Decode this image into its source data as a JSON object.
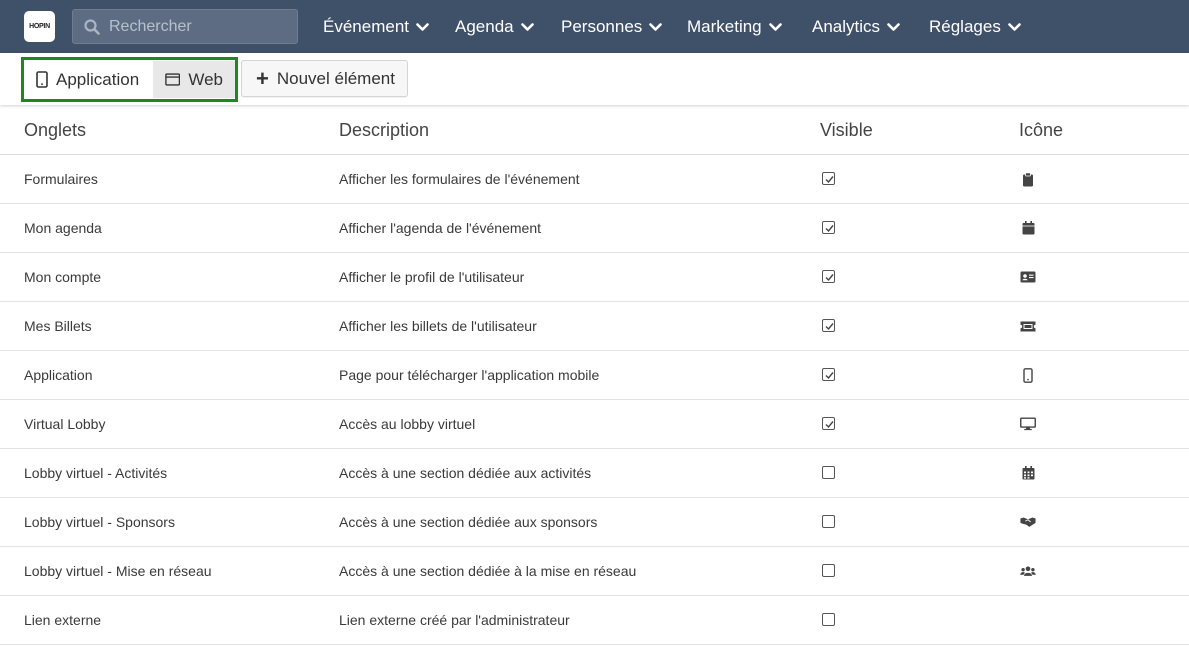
{
  "navbar": {
    "logo_text": "HOPIN",
    "search_placeholder": "Rechercher",
    "menu": [
      {
        "label": "Événement"
      },
      {
        "label": "Agenda"
      },
      {
        "label": "Personnes"
      },
      {
        "label": "Marketing"
      },
      {
        "label": "Analytics"
      },
      {
        "label": "Réglages"
      }
    ]
  },
  "toolbar": {
    "app_label": "Application",
    "web_label": "Web",
    "new_label": "Nouvel élément",
    "highlight_color": "#1a8a1a"
  },
  "table": {
    "headers": {
      "tabs": "Onglets",
      "description": "Description",
      "visible": "Visible",
      "icon": "Icône"
    },
    "rows": [
      {
        "name": "Formulaires",
        "description": "Afficher les formulaires de l'événement",
        "visible": true,
        "icon": "clipboard-icon"
      },
      {
        "name": "Mon agenda",
        "description": "Afficher l'agenda de l'événement",
        "visible": true,
        "icon": "calendar-icon"
      },
      {
        "name": "Mon compte",
        "description": "Afficher le profil de l'utilisateur",
        "visible": true,
        "icon": "id-card-icon"
      },
      {
        "name": "Mes Billets",
        "description": "Afficher les billets de l'utilisateur",
        "visible": true,
        "icon": "ticket-icon"
      },
      {
        "name": "Application",
        "description": "Page pour télécharger l'application mobile",
        "visible": true,
        "icon": "mobile-icon"
      },
      {
        "name": "Virtual Lobby",
        "description": "Accès au lobby virtuel",
        "visible": true,
        "icon": "desktop-icon"
      },
      {
        "name": "Lobby virtuel - Activités",
        "description": "Accès à une section dédiée aux activités",
        "visible": false,
        "icon": "calendar-grid-icon"
      },
      {
        "name": "Lobby virtuel - Sponsors",
        "description": "Accès à une section dédiée aux sponsors",
        "visible": false,
        "icon": "handshake-icon"
      },
      {
        "name": "Lobby virtuel - Mise en réseau",
        "description": "Accès à une section dédiée à la mise en réseau",
        "visible": false,
        "icon": "users-icon"
      },
      {
        "name": "Lien externe",
        "description": "Lien externe créé par l'administrateur",
        "visible": false,
        "icon": ""
      }
    ]
  }
}
